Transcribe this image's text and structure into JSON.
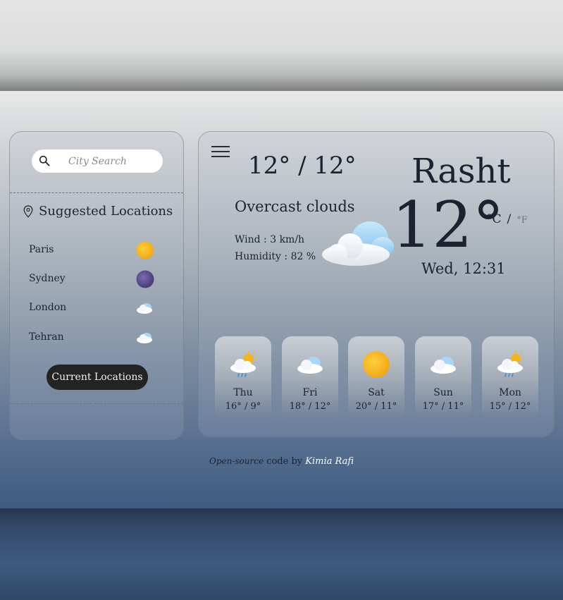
{
  "search": {
    "placeholder": "City Search"
  },
  "suggested": {
    "title": "Suggested Locations",
    "items": [
      {
        "name": "Paris",
        "icon": "sun-icon"
      },
      {
        "name": "Sydney",
        "icon": "night-moon-icon"
      },
      {
        "name": "London",
        "icon": "cloud-icon"
      },
      {
        "name": "Tehran",
        "icon": "cloud-icon"
      }
    ],
    "current_button": "Current Locations"
  },
  "weather": {
    "min_max": "12° / 12°",
    "condition": "Overcast clouds",
    "wind": "Wind : 3 km/h",
    "humidity": "Humidity : 82 %",
    "city": "Rasht",
    "temperature": "12°",
    "unit_c": "°C",
    "unit_sep": "/",
    "unit_f": "°F",
    "datetime": "Wed, 12:31"
  },
  "forecast": [
    {
      "day": "Thu",
      "range": "16° / 9°",
      "icon": "sun-cloud-rain-icon"
    },
    {
      "day": "Fri",
      "range": "18° / 12°",
      "icon": "cloud-icon"
    },
    {
      "day": "Sat",
      "range": "20° / 11°",
      "icon": "sun-icon"
    },
    {
      "day": "Sun",
      "range": "17° / 11°",
      "icon": "cloud-icon"
    },
    {
      "day": "Mon",
      "range": "15° / 12°",
      "icon": "sun-cloud-rain-icon"
    }
  ],
  "footer": {
    "prefix": "Open-source",
    "middle": " code by ",
    "author": "Kimia Rafi"
  },
  "colors": {
    "sun": "#f4b41a",
    "night": "#5a4e8c",
    "cloud_blue": "#9dd0f2",
    "button": "#232323"
  }
}
